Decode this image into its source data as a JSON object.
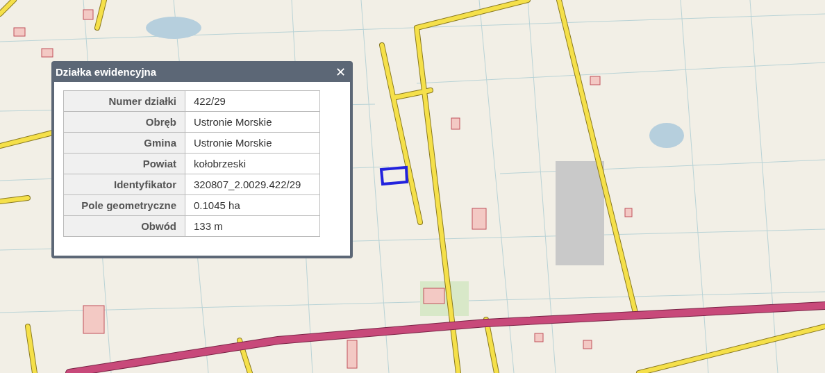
{
  "popup": {
    "title": "Działka ewidencyjna",
    "close": "✕",
    "rows": [
      {
        "label": "Numer działki",
        "value": "422/29"
      },
      {
        "label": "Obręb",
        "value": "Ustronie Morskie"
      },
      {
        "label": "Gmina",
        "value": "Ustronie Morskie"
      },
      {
        "label": "Powiat",
        "value": "kołobrzeski"
      },
      {
        "label": "Identyfikator",
        "value": "320807_2.0029.422/29"
      },
      {
        "label": "Pole geometryczne",
        "value": "0.1045 ha"
      },
      {
        "label": "Obwód",
        "value": "133 m"
      }
    ]
  }
}
